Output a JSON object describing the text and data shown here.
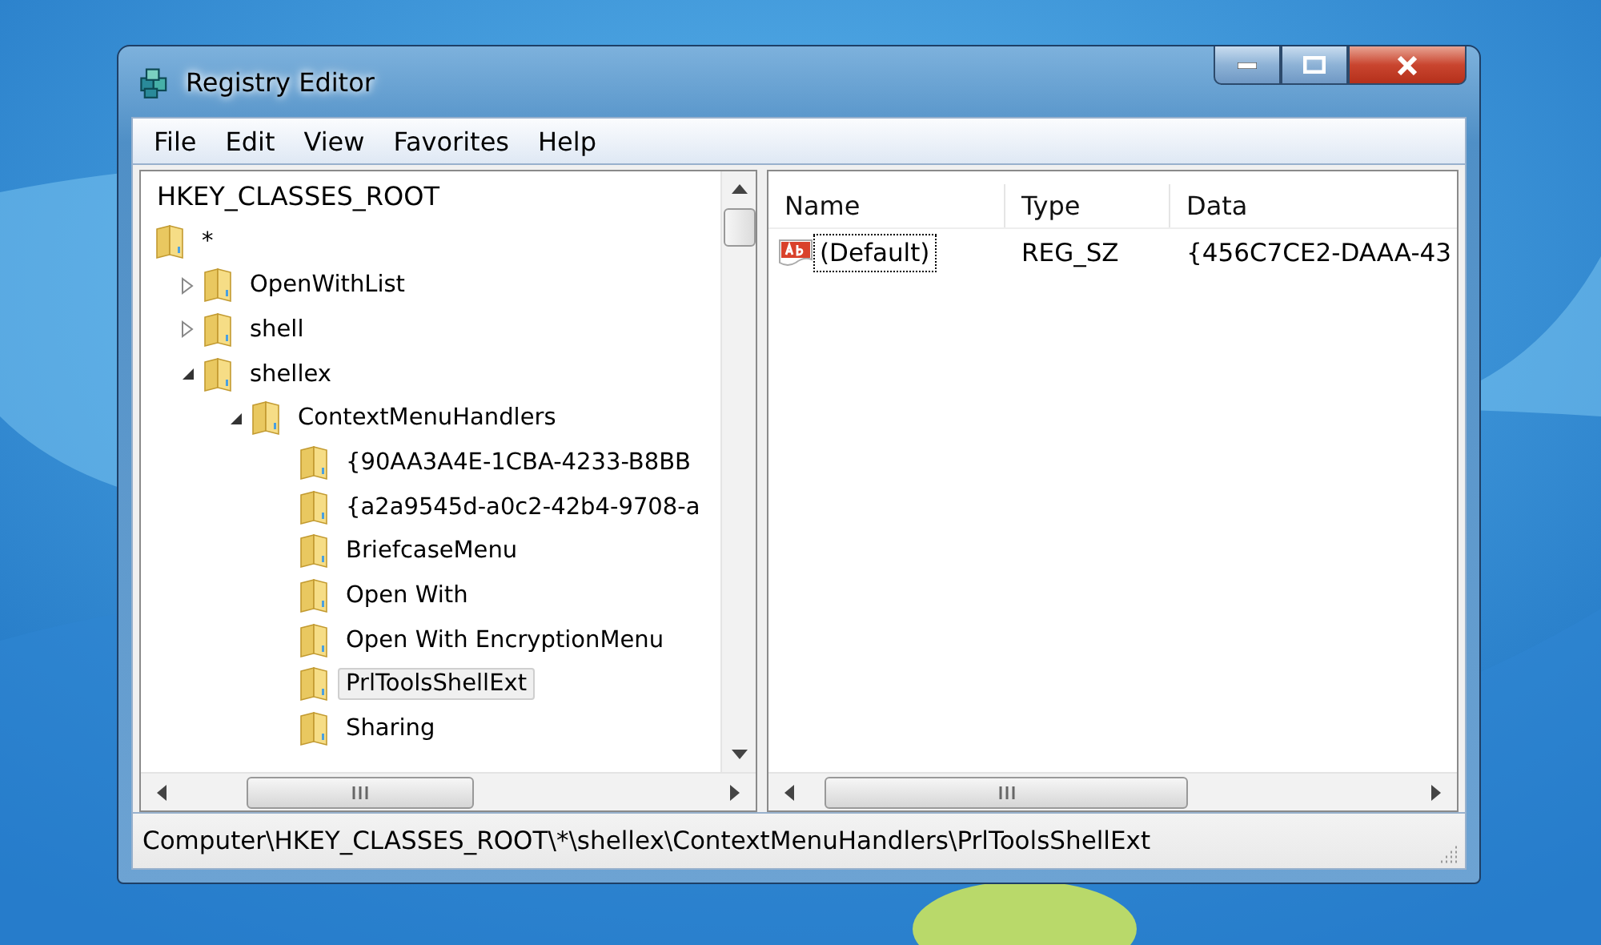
{
  "window": {
    "title": "Registry Editor"
  },
  "menu": [
    "File",
    "Edit",
    "View",
    "Favorites",
    "Help"
  ],
  "tree": {
    "root": "HKEY_CLASSES_ROOT",
    "items": [
      {
        "label": "*",
        "selected": false,
        "children": [
          {
            "label": "OpenWithList",
            "expanded": false,
            "selected": false
          },
          {
            "label": "shell",
            "expanded": false,
            "selected": false
          },
          {
            "label": "shellex",
            "expanded": true,
            "selected": false,
            "children": [
              {
                "label": "ContextMenuHandlers",
                "expanded": true,
                "selected": false,
                "children": [
                  {
                    "label": "{90AA3A4E-1CBA-4233-B8BB",
                    "selected": false
                  },
                  {
                    "label": "{a2a9545d-a0c2-42b4-9708-a",
                    "selected": false
                  },
                  {
                    "label": "BriefcaseMenu",
                    "selected": false
                  },
                  {
                    "label": "Open With",
                    "selected": false
                  },
                  {
                    "label": "Open With EncryptionMenu",
                    "selected": false
                  },
                  {
                    "label": "PrlToolsShellExt",
                    "selected": true
                  },
                  {
                    "label": "Sharing",
                    "selected": false
                  }
                ]
              }
            ]
          }
        ]
      }
    ]
  },
  "values": {
    "columns": [
      "Name",
      "Type",
      "Data"
    ],
    "rows": [
      {
        "name": "(Default)",
        "type": "REG_SZ",
        "data": "{456C7CE2-DAAA-43",
        "focused": true
      }
    ]
  },
  "status_bar": "Computer\\HKEY_CLASSES_ROOT\\*\\shellex\\ContextMenuHandlers\\PrlToolsShellExt"
}
